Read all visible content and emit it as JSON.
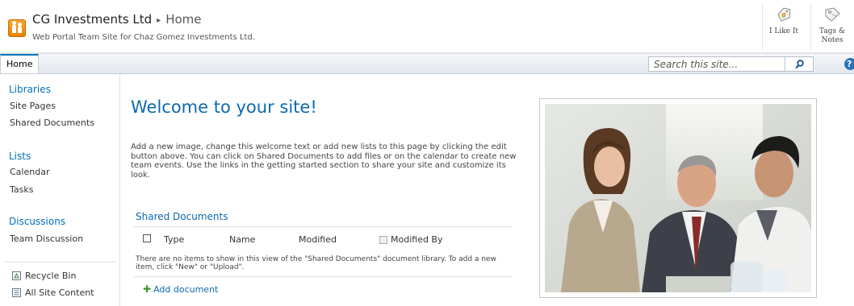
{
  "header": {
    "site_title": "CG Investments Ltd",
    "breadcrumb_separator": "▸",
    "current_page": "Home",
    "description": "Web Portal Team Site for Chaz Gomez Investments Ltd.",
    "logo_icon": "team-site-logo-icon",
    "social": {
      "like_label": "I Like It",
      "like_icon": "thumbs-up-icon",
      "tags_label_line1": "Tags &",
      "tags_label_line2": "Notes",
      "tags_icon": "tag-icon"
    }
  },
  "topnav": {
    "tabs": [
      {
        "label": "Home",
        "selected": true
      }
    ],
    "search": {
      "placeholder": "Search this site...",
      "icon": "search-icon"
    },
    "help_label": "?"
  },
  "leftnav": {
    "libraries": {
      "heading": "Libraries",
      "items": [
        "Site Pages",
        "Shared Documents"
      ]
    },
    "lists": {
      "heading": "Lists",
      "items": [
        "Calendar",
        "Tasks"
      ]
    },
    "discussions": {
      "heading": "Discussions",
      "items": [
        "Team Discussion"
      ]
    },
    "bottom": [
      {
        "label": "Recycle Bin",
        "icon": "recycle-bin-icon"
      },
      {
        "label": "All Site Content",
        "icon": "all-site-content-icon"
      }
    ]
  },
  "main": {
    "title": "Welcome to your site!",
    "intro": "Add a new image, change this welcome text or add new lists to this page by clicking the edit button above. You can click on Shared Documents to add files or on the calendar to create new team events. Use the links in the getting started section to share your site and customize its look.",
    "shared_documents": {
      "title": "Shared Documents",
      "columns": [
        "Type",
        "Name",
        "Modified",
        "Modified By"
      ],
      "empty_message": "There are no items to show in this view of the \"Shared Documents\" document library. To add a new item, click \"New\" or \"Upload\".",
      "add_label": "Add document",
      "add_icon": "plus-icon"
    },
    "image_icon": "welcome-photo"
  },
  "colors": {
    "accent": "#0c6ab0",
    "logo": "#f39200",
    "add_plus": "#3a9a2a"
  }
}
